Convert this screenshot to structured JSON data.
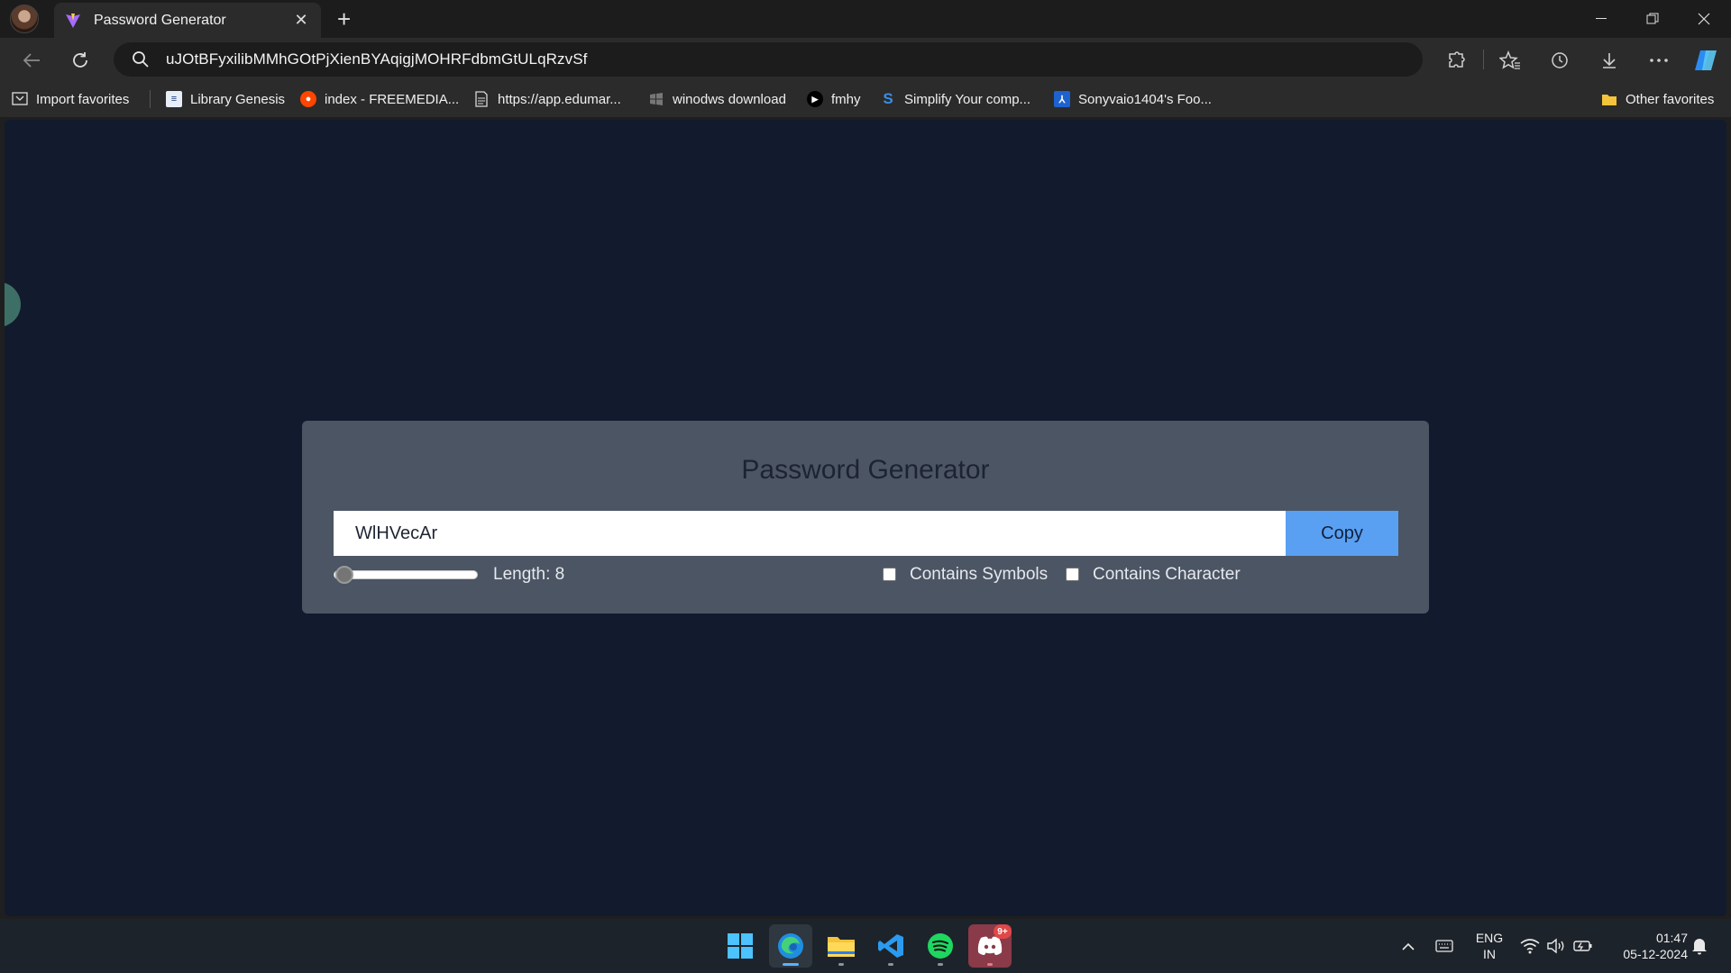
{
  "browser": {
    "tab": {
      "title": "Password Generator",
      "favicon": "vite-icon"
    },
    "address": "uJOtBFyxilibMMhGOtPjXienBYAqigjMOHRFdbmGtULqRzvSf",
    "favorites": [
      {
        "label": "Import favorites",
        "icon": "import-icon"
      },
      {
        "label": "Library Genesis",
        "icon": "book-icon"
      },
      {
        "label": "index - FREEMEDIA...",
        "icon": "reddit-icon"
      },
      {
        "label": "https://app.edumar...",
        "icon": "page-icon"
      },
      {
        "label": "winodws download",
        "icon": "windows-icon"
      },
      {
        "label": "fmhy",
        "icon": "play-icon"
      },
      {
        "label": "Simplify Your comp...",
        "icon": "s-icon"
      },
      {
        "label": "Sonyvaio1404's Foo...",
        "icon": "profile-icon"
      }
    ],
    "other_favorites": "Other favorites"
  },
  "app": {
    "title": "Password Generator",
    "password": "WlHVecAr",
    "copy_label": "Copy",
    "length_label": "Length: 8",
    "length_value": 8,
    "symbols_label": "Contains Symbols",
    "symbols_checked": false,
    "character_label": "Contains Character",
    "character_checked": false
  },
  "taskbar": {
    "apps": [
      "windows-start-icon",
      "edge-icon",
      "file-explorer-icon",
      "vscode-icon",
      "spotify-icon",
      "discord-icon"
    ],
    "discord_badge": "9+",
    "language": {
      "line1": "ENG",
      "line2": "IN"
    },
    "time": "01:47",
    "date": "05-12-2024"
  },
  "colors": {
    "page_bg": "#121a2d",
    "card_bg": "#4b5564",
    "copy_button": "#5aa0f2"
  }
}
